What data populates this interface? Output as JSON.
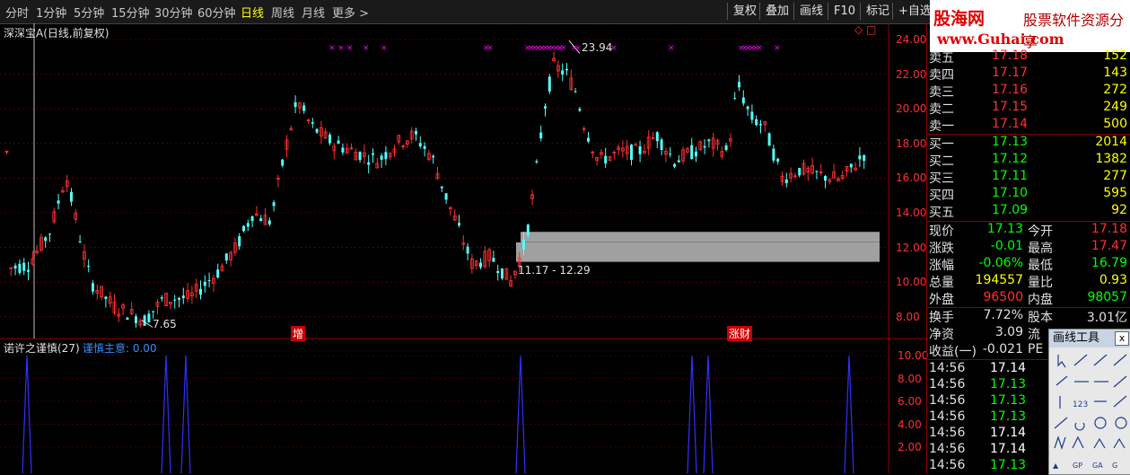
{
  "toolbar": {
    "periods": [
      "分时",
      "1分钟",
      "5分钟",
      "15分钟",
      "30分钟",
      "60分钟",
      "日线",
      "周线",
      "月线",
      "更多 >"
    ],
    "active": "日线",
    "buttons": [
      "复权",
      "叠加",
      "画线",
      "F10",
      "标记",
      "+自选"
    ]
  },
  "logo": {
    "cn": "股海网",
    "slogan": "股票软件资源分享",
    "url": "www.Guhai.com"
  },
  "main_chart": {
    "title": "深深宝A(日线,前复权)",
    "yaxis": [
      "24.00",
      "22.00",
      "20.00",
      "18.00",
      "16.00",
      "14.00",
      "12.00",
      "10.00",
      "8.00"
    ],
    "high_label": "23.94",
    "low_label": "7.65",
    "range_label": "11.17 - 12.29",
    "markers": [
      "增",
      "涨财"
    ],
    "corner_icons": [
      "diamond-icon",
      "square-icon"
    ]
  },
  "indicator": {
    "title": "诺许之谨慎(27)",
    "value_label": "谨慎主意: 0.00",
    "yaxis": [
      "10.00",
      "8.00",
      "6.00",
      "4.00",
      "2.00"
    ]
  },
  "colors": {
    "up": "#ff3030",
    "down": "#54ffff",
    "signal": "#ff00ff",
    "ind_line": "#3030ff",
    "grid": "#8b0000"
  },
  "quote": {
    "asks": [
      {
        "label": "卖五",
        "price": "17.18",
        "vol": "152"
      },
      {
        "label": "卖四",
        "price": "17.17",
        "vol": "143"
      },
      {
        "label": "卖三",
        "price": "17.16",
        "vol": "272"
      },
      {
        "label": "卖二",
        "price": "17.15",
        "vol": "249"
      },
      {
        "label": "卖一",
        "price": "17.14",
        "vol": "500"
      }
    ],
    "bids": [
      {
        "label": "买一",
        "price": "17.13",
        "vol": "2014"
      },
      {
        "label": "买二",
        "price": "17.12",
        "vol": "1382"
      },
      {
        "label": "买三",
        "price": "17.11",
        "vol": "277"
      },
      {
        "label": "买四",
        "price": "17.10",
        "vol": "595"
      },
      {
        "label": "买五",
        "price": "17.09",
        "vol": "92"
      }
    ],
    "stats": [
      {
        "l1": "现价",
        "v1": "17.13",
        "c1": "#00ff00",
        "l2": "今开",
        "v2": "17.18",
        "c2": "#ff3030"
      },
      {
        "l1": "涨跌",
        "v1": "-0.01",
        "c1": "#00ff00",
        "l2": "最高",
        "v2": "17.47",
        "c2": "#ff3030"
      },
      {
        "l1": "涨幅",
        "v1": "-0.06%",
        "c1": "#00ff00",
        "l2": "最低",
        "v2": "16.79",
        "c2": "#00ff00"
      },
      {
        "l1": "总量",
        "v1": "194557",
        "c1": "#ffff00",
        "l2": "量比",
        "v2": "0.93",
        "c2": "#ffff00"
      },
      {
        "l1": "外盘",
        "v1": "96500",
        "c1": "#ff3030",
        "l2": "内盘",
        "v2": "98057",
        "c2": "#00ff00"
      }
    ],
    "info": [
      {
        "l1": "换手",
        "v1": "7.72%",
        "l2": "股本",
        "v2": "3.01亿"
      },
      {
        "l1": "净资",
        "v1": "3.09",
        "l2": "流",
        "v2": ""
      },
      {
        "l1": "收益(一)",
        "v1": "-0.021",
        "l2": "PE",
        "v2": ""
      }
    ],
    "ticks": [
      {
        "time": "14:56",
        "price": "17.14"
      },
      {
        "time": "14:56",
        "price": "17.13"
      },
      {
        "time": "14:56",
        "price": "17.13"
      },
      {
        "time": "14:56",
        "price": "17.13"
      },
      {
        "time": "14:56",
        "price": "17.14"
      },
      {
        "time": "14:56",
        "price": "17.14"
      },
      {
        "time": "14:56",
        "price": "17.13"
      }
    ]
  },
  "drawing_tools": {
    "title": "画线工具",
    "close": "x"
  }
}
